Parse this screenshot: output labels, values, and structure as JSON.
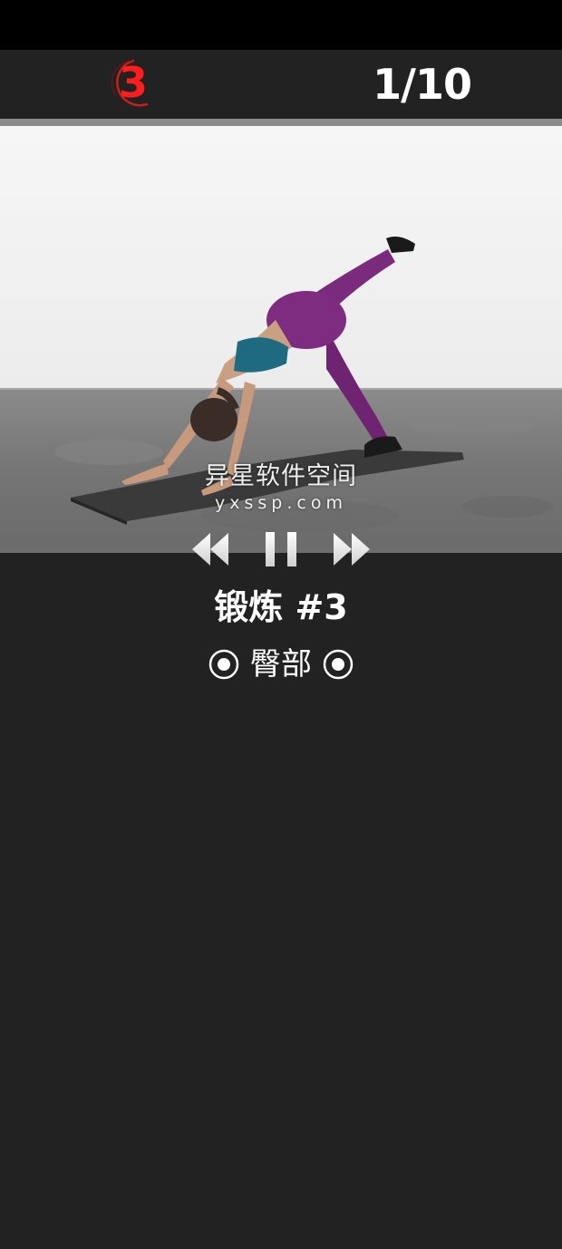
{
  "countdown": {
    "value": "3",
    "color": "#ff1d1d"
  },
  "progress": {
    "label": "1/10",
    "current": 1,
    "total": 10
  },
  "video": {
    "watermark_title": "异星软件空间",
    "watermark_url": "yxssp.com"
  },
  "controls": {
    "rewind_icon": "rewind-icon",
    "pause_icon": "pause-icon",
    "forward_icon": "fast-forward-icon"
  },
  "exercise": {
    "title": "锻炼 #3",
    "body_part": "臀部",
    "icon": "target-icon"
  },
  "colors": {
    "background": "#222222",
    "accent": "#ff1d1d",
    "text": "#ffffff"
  }
}
